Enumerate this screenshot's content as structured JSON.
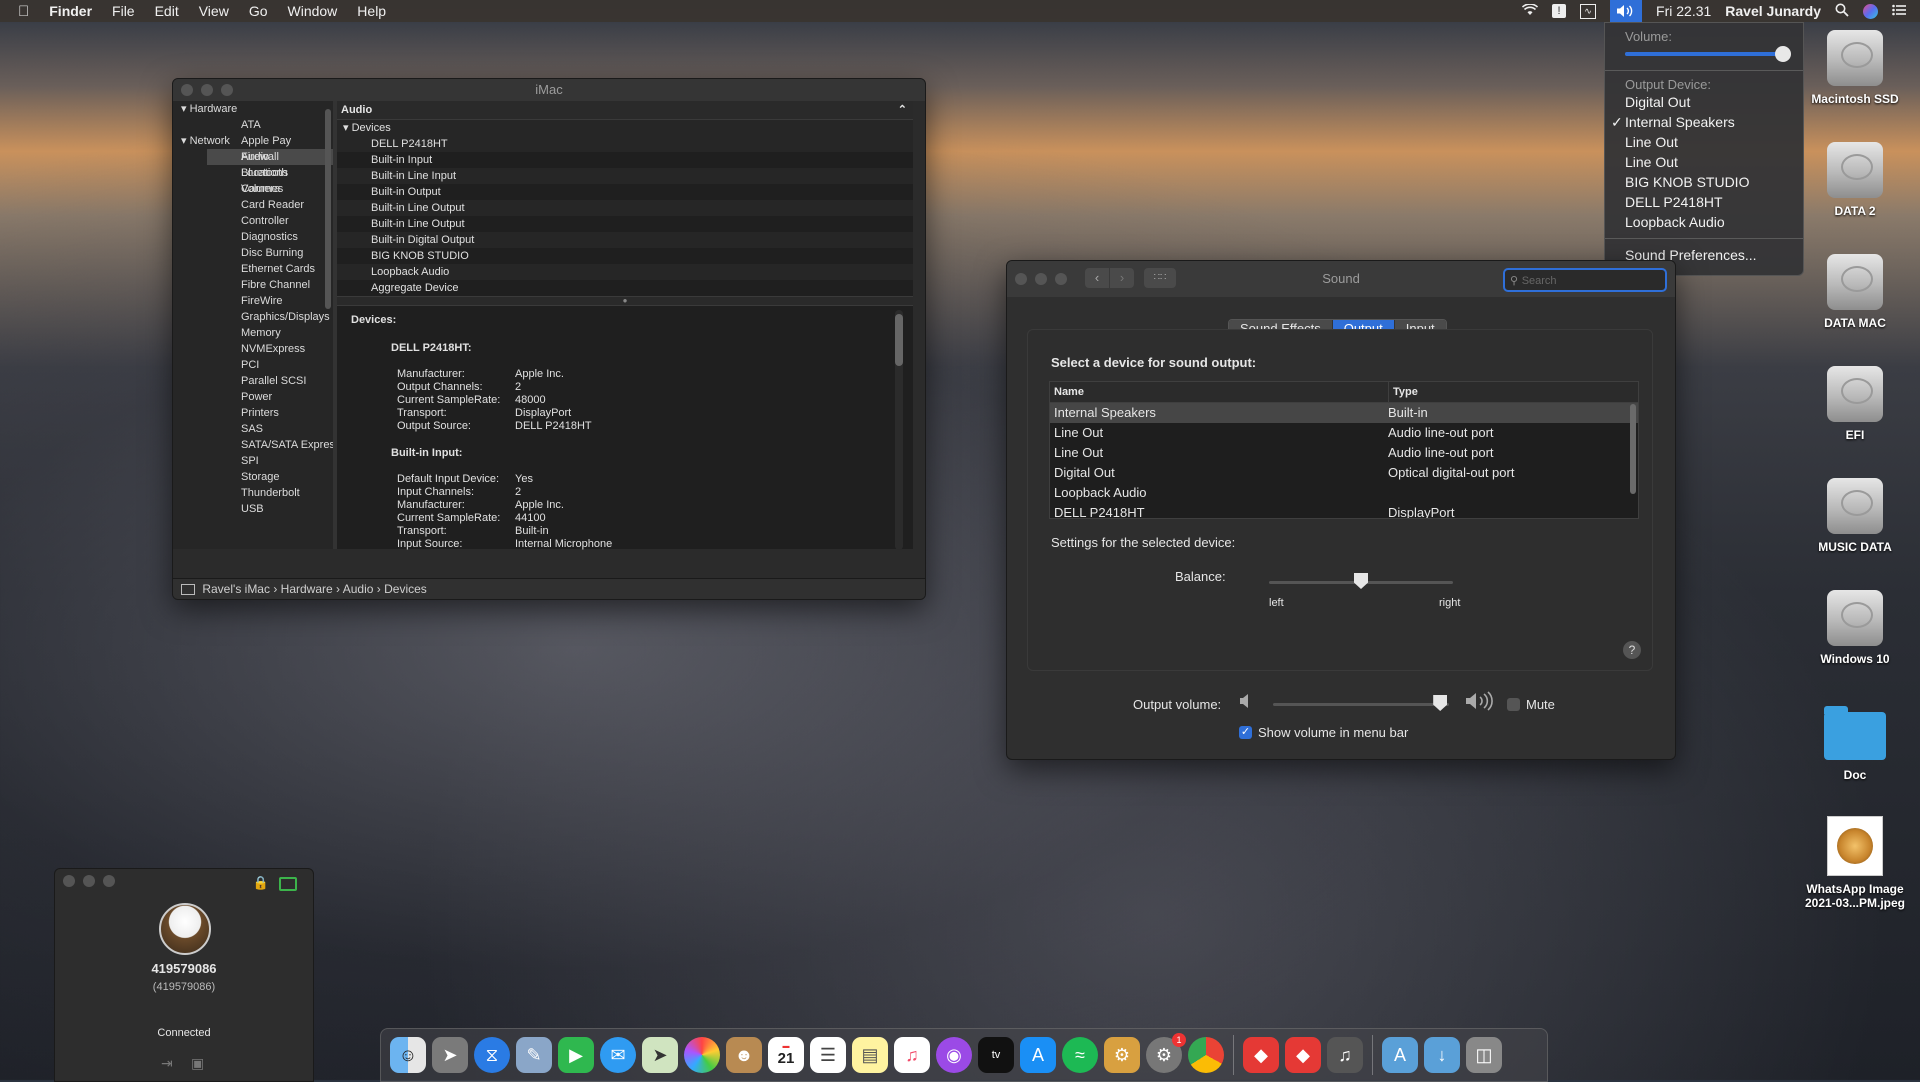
{
  "menubar": {
    "app_name": "Finder",
    "menus": [
      "File",
      "Edit",
      "View",
      "Go",
      "Window",
      "Help"
    ],
    "clock": "Fri 22.31",
    "user": "Ravel Junardy"
  },
  "volume_menu": {
    "volume_label": "Volume:",
    "volume_value": 1.0,
    "output_label": "Output Device:",
    "devices": [
      "Digital Out",
      "Internal Speakers",
      "Line Out",
      "Line Out",
      "BIG KNOB STUDIO",
      "DELL P2418HT",
      "Loopback Audio"
    ],
    "selected_index": 1,
    "preferences": "Sound Preferences..."
  },
  "sysinfo": {
    "title": "iMac",
    "sidebar": {
      "hardware_header": "Hardware",
      "hardware_items": [
        "ATA",
        "Apple Pay",
        "Audio",
        "Bluetooth",
        "Camera",
        "Card Reader",
        "Controller",
        "Diagnostics",
        "Disc Burning",
        "Ethernet Cards",
        "Fibre Channel",
        "FireWire",
        "Graphics/Displays",
        "Memory",
        "NVMExpress",
        "PCI",
        "Parallel SCSI",
        "Power",
        "Printers",
        "SAS",
        "SATA/SATA Express",
        "SPI",
        "Storage",
        "Thunderbolt",
        "USB"
      ],
      "network_header": "Network",
      "network_items": [
        "Firewall",
        "Locations",
        "Volumes"
      ],
      "selected": "Audio"
    },
    "list_header": "Audio",
    "devices_group": "Devices",
    "devices": [
      "DELL P2418HT",
      "Built-in Input",
      "Built-in Line Input",
      "Built-in Output",
      "Built-in Line Output",
      "Built-in Line Output",
      "Built-in Digital Output",
      "BIG KNOB STUDIO",
      "Loopback Audio",
      "Aggregate Device"
    ],
    "detail": {
      "heading": "Devices:",
      "dev1_name": "DELL P2418HT:",
      "dev1": [
        {
          "k": "Manufacturer:",
          "v": "Apple Inc."
        },
        {
          "k": "Output Channels:",
          "v": "2"
        },
        {
          "k": "Current SampleRate:",
          "v": "48000"
        },
        {
          "k": "Transport:",
          "v": "DisplayPort"
        },
        {
          "k": "Output Source:",
          "v": "DELL P2418HT"
        }
      ],
      "dev2_name": "Built-in Input:",
      "dev2": [
        {
          "k": "Default Input Device:",
          "v": "Yes"
        },
        {
          "k": "Input Channels:",
          "v": "2"
        },
        {
          "k": "Manufacturer:",
          "v": "Apple Inc."
        },
        {
          "k": "Current SampleRate:",
          "v": "44100"
        },
        {
          "k": "Transport:",
          "v": "Built-in"
        },
        {
          "k": "Input Source:",
          "v": "Internal Microphone"
        }
      ]
    },
    "path": [
      "Ravel's iMac",
      "Hardware",
      "Audio",
      "Devices"
    ]
  },
  "sound": {
    "title": "Sound",
    "search_placeholder": "Search",
    "tabs": [
      "Sound Effects",
      "Output",
      "Input"
    ],
    "active_tab": "Output",
    "select_label": "Select a device for sound output:",
    "col_name": "Name",
    "col_type": "Type",
    "rows": [
      {
        "name": "Internal Speakers",
        "type": "Built-in"
      },
      {
        "name": "Line Out",
        "type": "Audio line-out port"
      },
      {
        "name": "Line Out",
        "type": "Audio line-out port"
      },
      {
        "name": "Digital Out",
        "type": "Optical digital-out port"
      },
      {
        "name": "Loopback Audio",
        "type": ""
      },
      {
        "name": "DELL P2418HT",
        "type": "DisplayPort"
      }
    ],
    "settings_label": "Settings for the selected device:",
    "balance_label": "Balance:",
    "balance_left": "left",
    "balance_right": "right",
    "balance_value": 0.5,
    "help": "?",
    "output_volume_label": "Output volume:",
    "output_volume_value": 0.95,
    "mute_label": "Mute",
    "show_volume_label": "Show volume in menu bar"
  },
  "desktop": {
    "icons": [
      {
        "label": "Macintosh SSD",
        "kind": "disk"
      },
      {
        "label": "DATA 2",
        "kind": "disk"
      },
      {
        "label": "DATA MAC",
        "kind": "disk"
      },
      {
        "label": "EFI",
        "kind": "disk"
      },
      {
        "label": "MUSIC DATA",
        "kind": "disk"
      },
      {
        "label": "Windows 10",
        "kind": "disk"
      },
      {
        "label": "Doc",
        "kind": "folder"
      },
      {
        "label": "WhatsApp Image 2021-03...PM.jpeg",
        "kind": "image"
      }
    ]
  },
  "remote": {
    "id": "419579086",
    "id_sub": "(419579086)",
    "status": "Connected"
  },
  "dock": {
    "calendar_day": "21",
    "badge": "1"
  },
  "colors": {
    "accent": "#2f6fd8",
    "window_bg": "#2b2b2b"
  }
}
